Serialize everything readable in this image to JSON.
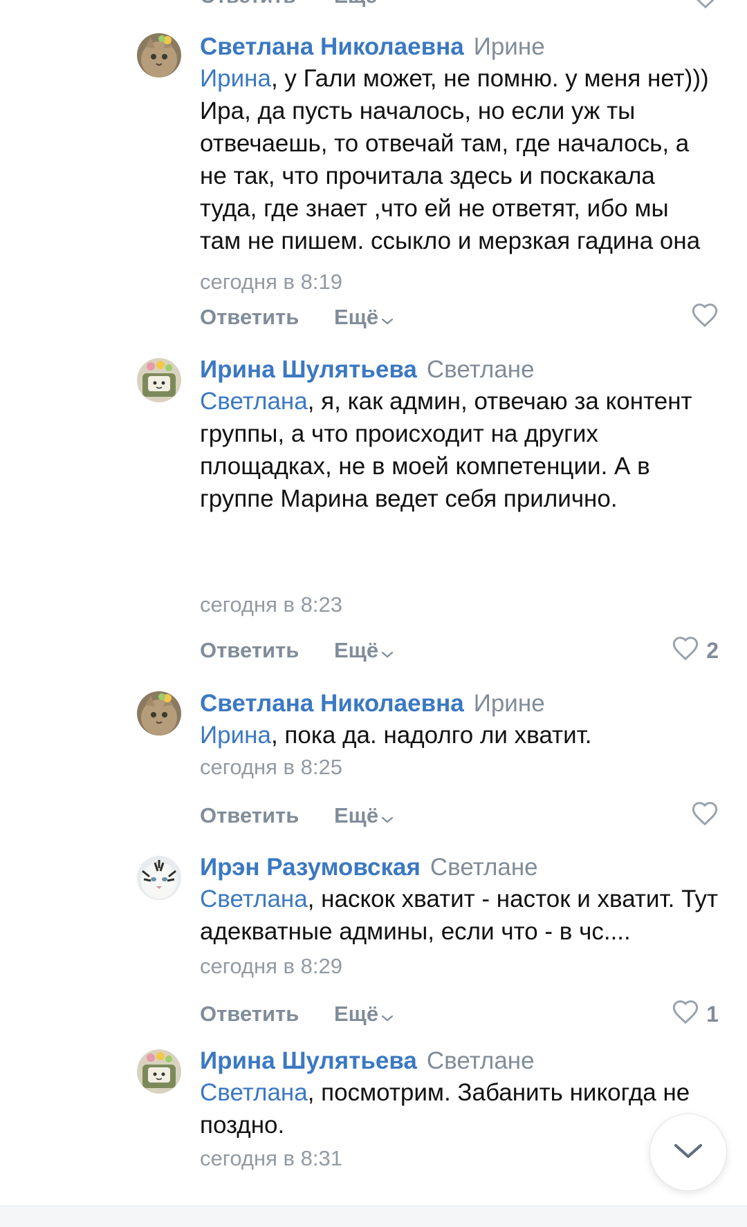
{
  "actions": {
    "reply_label": "Ответить",
    "more_label": "Ещё"
  },
  "colors": {
    "link": "#3b78c2",
    "secondary": "#818c99",
    "text": "#111111"
  },
  "comments": [
    {
      "author": "Светлана Николаевна",
      "reply_to": "Ирине",
      "mention": "Ирина",
      "text": ", у Гали может, не помню. у меня нет))) Ира, да пусть началось, но если уж ты отвечаешь, то отвечай там, где началось, а не так, что прочитала здесь и поскакала туда, где знает ,что ей не ответят, ибо мы там не пишем. ссыкло и мерзкая гадина она",
      "time": "сегодня в 8:19",
      "likes": "",
      "avatar_icon": "cat-avatar"
    },
    {
      "author": "Ирина Шулятьева",
      "reply_to": "Светлане",
      "mention": "Светлана",
      "text": ", я, как админ, отвечаю за контент группы, а что происходит на других площадках, не в моей компетенции. А в группе Марина ведет себя прилично.",
      "time": "сегодня в 8:23",
      "likes": "2",
      "avatar_icon": "doodle-avatar"
    },
    {
      "author": "Светлана Николаевна",
      "reply_to": "Ирине",
      "mention": "Ирина",
      "text": ", пока да. надолго ли хватит.",
      "time": "сегодня в 8:25",
      "likes": "",
      "avatar_icon": "cat-avatar"
    },
    {
      "author": "Ирэн Разумовская",
      "reply_to": "Светлане",
      "mention": "Светлана",
      "text": ", наскок хватит - насток и хватит. Тут адекватные админы, если что - в чс....",
      "time": "сегодня в 8:29",
      "likes": "1",
      "avatar_icon": "tiger-avatar"
    },
    {
      "author": "Ирина Шулятьева",
      "reply_to": "Светлане",
      "mention": "Светлана",
      "text": ", посмотрим. Забанить никогда не поздно.",
      "time": "сегодня в 8:31",
      "likes": "",
      "avatar_icon": "doodle-avatar"
    }
  ]
}
